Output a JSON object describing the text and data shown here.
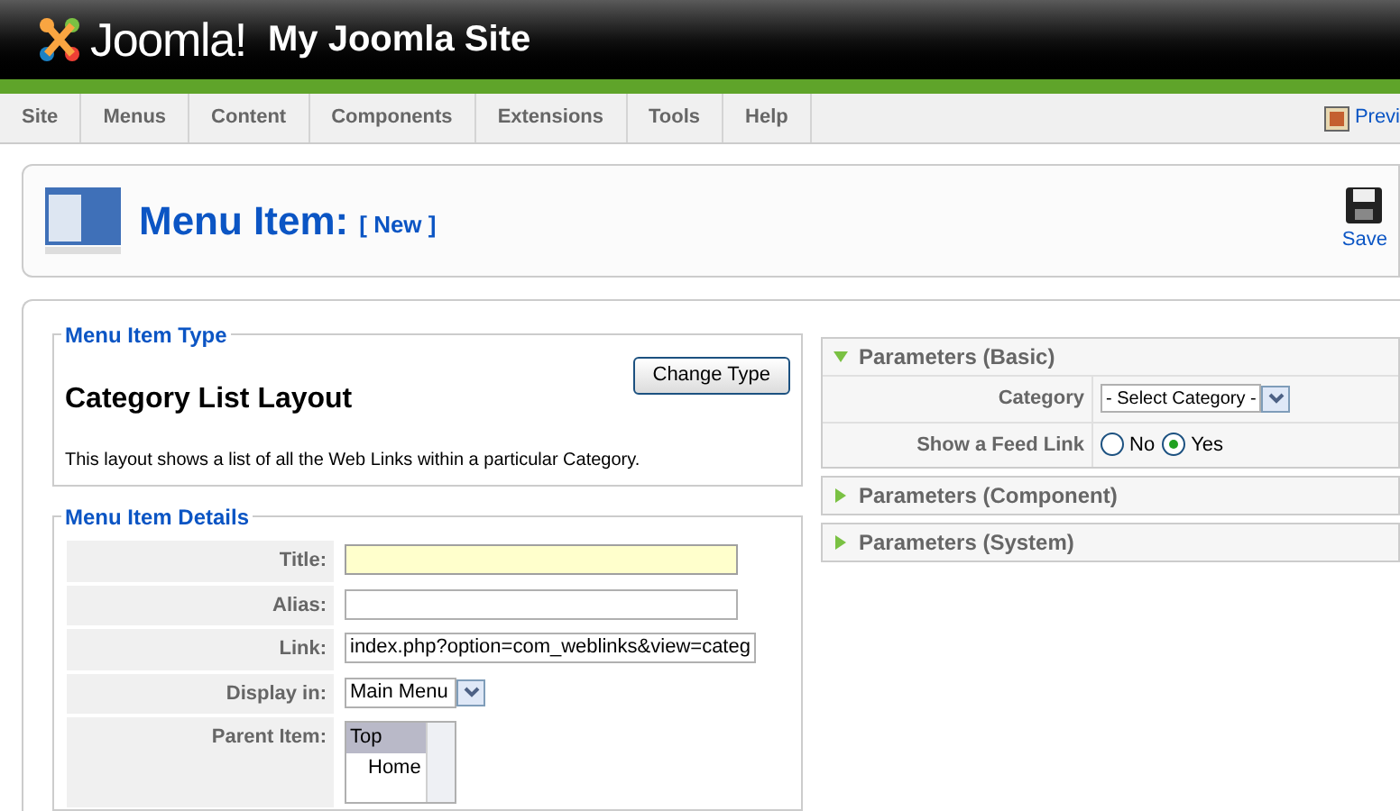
{
  "header": {
    "logo_text": "Joomla!",
    "site_title": "My Joomla Site"
  },
  "menu": [
    {
      "label": "Site"
    },
    {
      "label": "Menus"
    },
    {
      "label": "Content"
    },
    {
      "label": "Components"
    },
    {
      "label": "Extensions"
    },
    {
      "label": "Tools"
    },
    {
      "label": "Help"
    }
  ],
  "preview_link": "Previ",
  "toolbar": {
    "title": "Menu Item:",
    "subtitle": "[ New ]",
    "buttons": [
      {
        "label": "Save"
      }
    ]
  },
  "menu_item_type": {
    "legend": "Menu Item Type",
    "change_button": "Change Type",
    "layout_title": "Category List Layout",
    "description": "This layout shows a list of all the Web Links within a particular Category."
  },
  "menu_item_details": {
    "legend": "Menu Item Details",
    "fields": [
      {
        "kind": "text",
        "label": "Title:",
        "focused": true
      },
      {
        "kind": "text",
        "label": "Alias:",
        "focused": false
      },
      {
        "kind": "text",
        "label": "Link:",
        "value": "index.php?option=com_weblinks&view=categ",
        "focused": false
      },
      {
        "kind": "select",
        "label": "Display in:",
        "value": "Main Menu"
      },
      {
        "kind": "list",
        "label": "Parent Item:",
        "options": [
          {
            "label": "Top",
            "selected": true,
            "children": [
              {
                "label": "Home",
                "selected": false
              }
            ]
          }
        ]
      }
    ]
  },
  "parameters": [
    {
      "title": "Parameters (Basic)",
      "expanded": true,
      "rows": [
        {
          "kind": "select",
          "label": "Category",
          "value": "- Select Category -"
        },
        {
          "kind": "radio",
          "label": "Show a Feed Link",
          "options": [
            {
              "label": "No",
              "selected": false
            },
            {
              "label": "Yes",
              "selected": true
            }
          ]
        }
      ]
    },
    {
      "title": "Parameters (Component)",
      "expanded": false
    },
    {
      "title": "Parameters (System)",
      "expanded": false
    }
  ]
}
